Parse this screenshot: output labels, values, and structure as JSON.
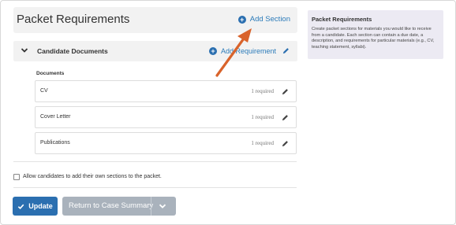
{
  "header": {
    "title": "Packet Requirements",
    "add_section_label": "Add Section"
  },
  "section": {
    "title": "Candidate Documents",
    "add_requirement_label": "Add Requirement",
    "documents_label": "Documents"
  },
  "documents": [
    {
      "name": "CV",
      "required": "1 required"
    },
    {
      "name": "Cover Letter",
      "required": "1 required"
    },
    {
      "name": "Publications",
      "required": "1 required"
    }
  ],
  "allow_checkbox": {
    "label": "Allow candidates to add their own sections to the packet.",
    "checked": false
  },
  "buttons": {
    "update_label": "Update",
    "return_label": "Return to Case Summary"
  },
  "help_panel": {
    "title": "Packet Requirements",
    "text": "Create packet sections for materials you would like to receive from a candidate. Each section can contain a due date, a description, and requirements for particular materials (e.g., CV, teaching statement, syllabi)."
  },
  "colors": {
    "accent": "#2b6fb0",
    "link": "#2b7bb9",
    "annotation_arrow": "#d9632b",
    "panel_bg": "#eceaf3"
  }
}
